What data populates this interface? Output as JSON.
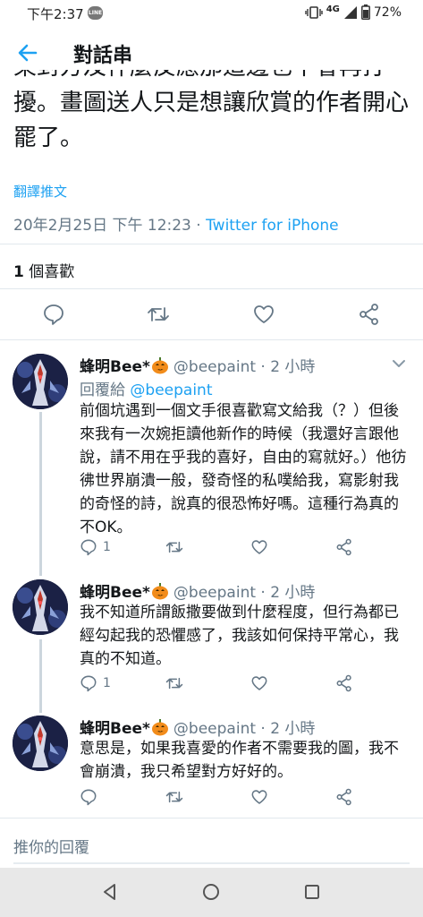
{
  "status_bar": {
    "time": "下午2:37",
    "line_badge": "LINE",
    "network": "4G",
    "battery": "72%"
  },
  "header": {
    "title": "對話串"
  },
  "tweet": {
    "clipped_line": "某對方及什麼反應那這邊也不會再打",
    "text": "擾。畫圖送人只是想讓欣賞的作者開心罷了。",
    "translate_label": "翻譯推文",
    "timestamp": "20年2月25日 下午 12:23 · ",
    "source": "Twitter for iPhone",
    "likes_count": "1",
    "likes_label": " 個喜歡"
  },
  "replies": [
    {
      "name": "蜂明Bee*",
      "handle": "@beepaint · 2 小時",
      "replying_label": "回覆給 ",
      "replying_to": "@beepaint",
      "text": "前個坑遇到一個文手很喜歡寫文給我（？）但後來我有一次婉拒讀他新作的時候（我還好言跟他說，請不用在乎我的喜好，自由的寫就好。）他彷彿世界崩潰一般，發奇怪的私噗給我，寫影射我的奇怪的詩，說真的很恐怖好嗎。這種行為真的不OK。",
      "reply_count": "1"
    },
    {
      "name": "蜂明Bee*",
      "handle": "@beepaint · 2 小時",
      "text": "我不知道所謂飯撒要做到什麼程度，但行為都已經勾起我的恐懼感了，我該如何保持平常心，我真的不知道。",
      "reply_count": "1"
    },
    {
      "name": "蜂明Bee*",
      "handle": "@beepaint · 2 小時",
      "text": "意思是，如果我喜愛的作者不需要我的圖，我不會崩潰，我只希望對方好好的。",
      "reply_count": ""
    }
  ],
  "compose": {
    "placeholder": "推你的回覆"
  },
  "colors": {
    "accent": "#1da1f2",
    "secondary_text": "#657786",
    "primary_text": "#14171a",
    "divider": "#e1e8ed",
    "nav_bar": "#e8e8e8"
  }
}
